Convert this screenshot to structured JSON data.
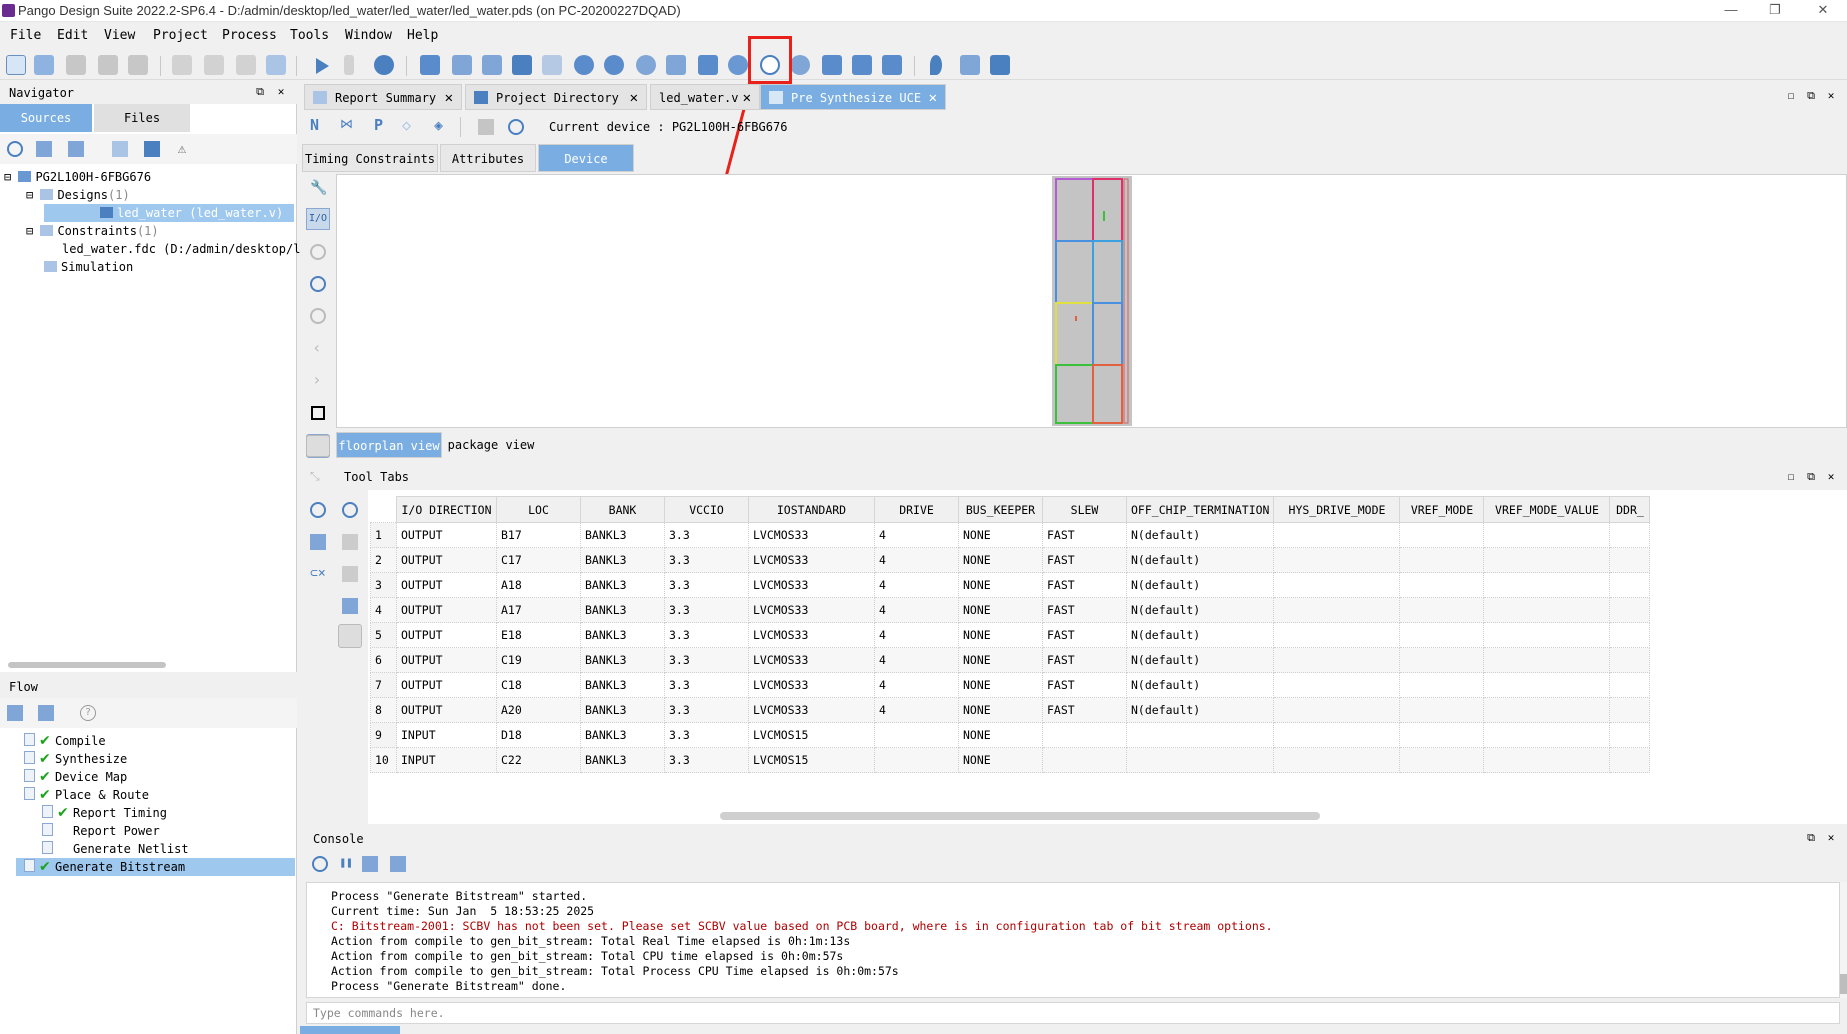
{
  "window": {
    "title": "Pango Design Suite 2022.2-SP6.4 - D:/admin/desktop/led_water/led_water/led_water.pds (on PC-20200227DQAD)",
    "controls": [
      "—",
      "❐",
      "✕"
    ]
  },
  "menu": [
    "File",
    "Edit",
    "View",
    "Project",
    "Process",
    "Tools",
    "Window",
    "Help"
  ],
  "navigator": {
    "title": "Navigator",
    "tabs": [
      "Sources",
      "Files"
    ],
    "tree": {
      "device": "PG2L100H-6FBG676",
      "designs_label": "Designs",
      "designs_count": "(1)",
      "design_file": "led_water (led_water.v)",
      "constraints_label": "Constraints",
      "constraints_count": "(1)",
      "constraint_file": "led_water.fdc (D:/admin/desktop/l",
      "simulation": "Simulation"
    }
  },
  "flow": {
    "title": "Flow",
    "items": [
      {
        "label": "Compile",
        "done": true,
        "indent": 0
      },
      {
        "label": "Synthesize",
        "done": true,
        "indent": 0
      },
      {
        "label": "Device Map",
        "done": true,
        "indent": 0
      },
      {
        "label": "Place & Route",
        "done": true,
        "indent": 0
      },
      {
        "label": "Report Timing",
        "done": true,
        "indent": 1
      },
      {
        "label": "Report Power",
        "done": false,
        "indent": 1
      },
      {
        "label": "Generate Netlist",
        "done": false,
        "indent": 1
      },
      {
        "label": "Generate Bitstream",
        "done": true,
        "indent": 0,
        "selected": true
      }
    ]
  },
  "editor_tabs": [
    "Report Summary",
    "Project Directory",
    "led_water.v",
    "Pre Synthesize UCE"
  ],
  "uce": {
    "current_device_label": "Current device : PG2L100H-6FBG676",
    "subtabs": [
      "Timing Constraints",
      "Attributes",
      "Device"
    ],
    "view_tabs": [
      "floorplan view",
      "package view"
    ]
  },
  "tool_tabs": {
    "title": "Tool Tabs",
    "columns": [
      "I/O DIRECTION",
      "LOC",
      "BANK",
      "VCCIO",
      "IOSTANDARD",
      "DRIVE",
      "BUS_KEEPER",
      "SLEW",
      "OFF_CHIP_TERMINATION",
      "HYS_DRIVE_MODE",
      "VREF_MODE",
      "VREF_MODE_VALUE",
      "DDR_"
    ],
    "rows": [
      [
        "1",
        "OUTPUT",
        "B17",
        "BANKL3",
        "3.3",
        "LVCMOS33",
        "4",
        "NONE",
        "FAST",
        "N(default)",
        "",
        "",
        "",
        ""
      ],
      [
        "2",
        "OUTPUT",
        "C17",
        "BANKL3",
        "3.3",
        "LVCMOS33",
        "4",
        "NONE",
        "FAST",
        "N(default)",
        "",
        "",
        "",
        ""
      ],
      [
        "3",
        "OUTPUT",
        "A18",
        "BANKL3",
        "3.3",
        "LVCMOS33",
        "4",
        "NONE",
        "FAST",
        "N(default)",
        "",
        "",
        "",
        ""
      ],
      [
        "4",
        "OUTPUT",
        "A17",
        "BANKL3",
        "3.3",
        "LVCMOS33",
        "4",
        "NONE",
        "FAST",
        "N(default)",
        "",
        "",
        "",
        ""
      ],
      [
        "5",
        "OUTPUT",
        "E18",
        "BANKL3",
        "3.3",
        "LVCMOS33",
        "4",
        "NONE",
        "FAST",
        "N(default)",
        "",
        "",
        "",
        ""
      ],
      [
        "6",
        "OUTPUT",
        "C19",
        "BANKL3",
        "3.3",
        "LVCMOS33",
        "4",
        "NONE",
        "FAST",
        "N(default)",
        "",
        "",
        "",
        ""
      ],
      [
        "7",
        "OUTPUT",
        "C18",
        "BANKL3",
        "3.3",
        "LVCMOS33",
        "4",
        "NONE",
        "FAST",
        "N(default)",
        "",
        "",
        "",
        ""
      ],
      [
        "8",
        "OUTPUT",
        "A20",
        "BANKL3",
        "3.3",
        "LVCMOS33",
        "4",
        "NONE",
        "FAST",
        "N(default)",
        "",
        "",
        "",
        ""
      ],
      [
        "9",
        "INPUT",
        "D18",
        "BANKL3",
        "3.3",
        "LVCMOS15",
        "",
        "NONE",
        "",
        "",
        "",
        "",
        "",
        ""
      ],
      [
        "10",
        "INPUT",
        "C22",
        "BANKL3",
        "3.3",
        "LVCMOS15",
        "",
        "NONE",
        "",
        "",
        "",
        "",
        "",
        ""
      ]
    ]
  },
  "console": {
    "title": "Console",
    "lines": [
      {
        "text": "Process \"Generate Bitstream\" started.",
        "type": "info"
      },
      {
        "text": "Current time: Sun Jan  5 18:53:25 2025",
        "type": "info"
      },
      {
        "text": "C: Bitstream-2001: SCBV has not been set. Please set SCBV value based on PCB board, where is in configuration tab of bit stream options.",
        "type": "error"
      },
      {
        "text": "Action from compile to gen_bit_stream: Total Real Time elapsed is 0h:1m:13s",
        "type": "info"
      },
      {
        "text": "Action from compile to gen_bit_stream: Total CPU time elapsed is 0h:0m:57s",
        "type": "info"
      },
      {
        "text": "Action from compile to gen_bit_stream: Total Process CPU Time elapsed is 0h:0m:57s",
        "type": "info"
      },
      {
        "text": "Process \"Generate Bitstream\" done.",
        "type": "info"
      }
    ],
    "command_placeholder": "Type commands here."
  },
  "colors": {
    "accent": "#7aaee2",
    "highlight": "#e8221b",
    "check": "#1ba31b",
    "error_text": "#b00000"
  }
}
